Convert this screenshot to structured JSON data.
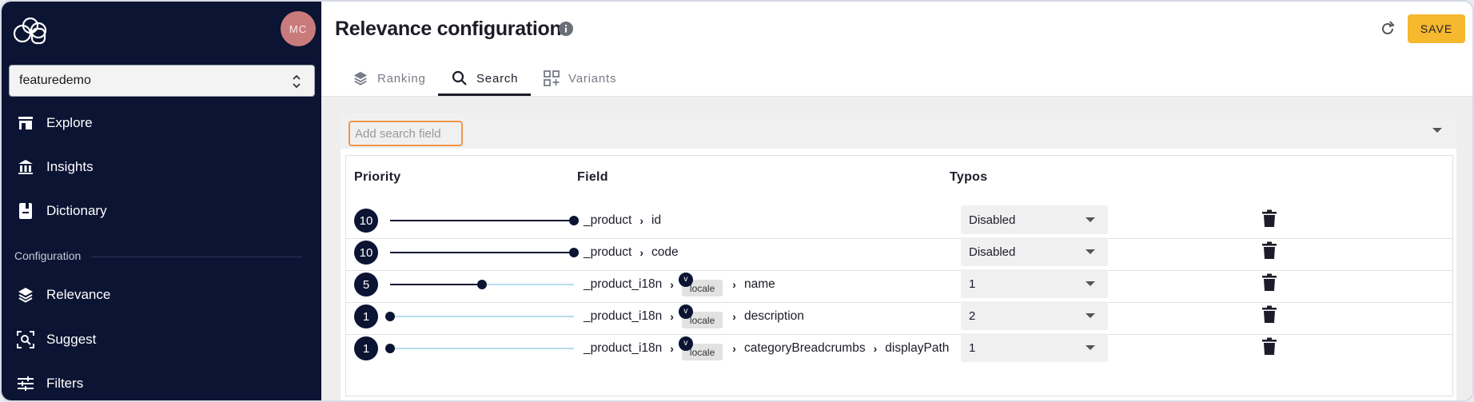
{
  "sidebar": {
    "avatar_initials": "MC",
    "catalog": "featuredemo",
    "nav_top": [
      {
        "label": "Explore",
        "icon": "storefront-icon"
      },
      {
        "label": "Insights",
        "icon": "bank-icon"
      },
      {
        "label": "Dictionary",
        "icon": "book-icon"
      }
    ],
    "section_label": "Configuration",
    "nav_config": [
      {
        "label": "Relevance",
        "icon": "layers-icon"
      },
      {
        "label": "Suggest",
        "icon": "scan-search-icon"
      },
      {
        "label": "Filters",
        "icon": "sliders-icon"
      }
    ]
  },
  "header": {
    "title": "Relevance configuration",
    "save_label": "SAVE",
    "accent_color": "#f5b82e"
  },
  "tabs": [
    {
      "label": "Ranking",
      "icon": "layers-icon",
      "active": false
    },
    {
      "label": "Search",
      "icon": "search-icon",
      "active": true
    },
    {
      "label": "Variants",
      "icon": "grid-add-icon",
      "active": false
    }
  ],
  "search": {
    "add_field_placeholder": "Add search field",
    "columns": {
      "priority": "Priority",
      "field": "Field",
      "typos": "Typos"
    },
    "slider_max": 10,
    "rows": [
      {
        "priority": "10",
        "priority_value": 10,
        "path": [
          "_product",
          "id"
        ],
        "variable": null,
        "typos": "Disabled"
      },
      {
        "priority": "10",
        "priority_value": 10,
        "path": [
          "_product",
          "code"
        ],
        "variable": null,
        "typos": "Disabled"
      },
      {
        "priority": "5",
        "priority_value": 5,
        "path": [
          "_product_i18n"
        ],
        "variable": {
          "badge": "v",
          "name": "locale"
        },
        "path_after": [
          "name"
        ],
        "typos": "1"
      },
      {
        "priority": "1",
        "priority_value": 0,
        "path": [
          "_product_i18n"
        ],
        "variable": {
          "badge": "v",
          "name": "locale"
        },
        "path_after": [
          "description"
        ],
        "typos": "2"
      },
      {
        "priority": "1",
        "priority_value": 0,
        "path": [
          "_product_i18n"
        ],
        "variable": {
          "badge": "v",
          "name": "locale"
        },
        "path_after": [
          "categoryBreadcrumbs",
          "displayPath"
        ],
        "typos": "1"
      }
    ]
  }
}
